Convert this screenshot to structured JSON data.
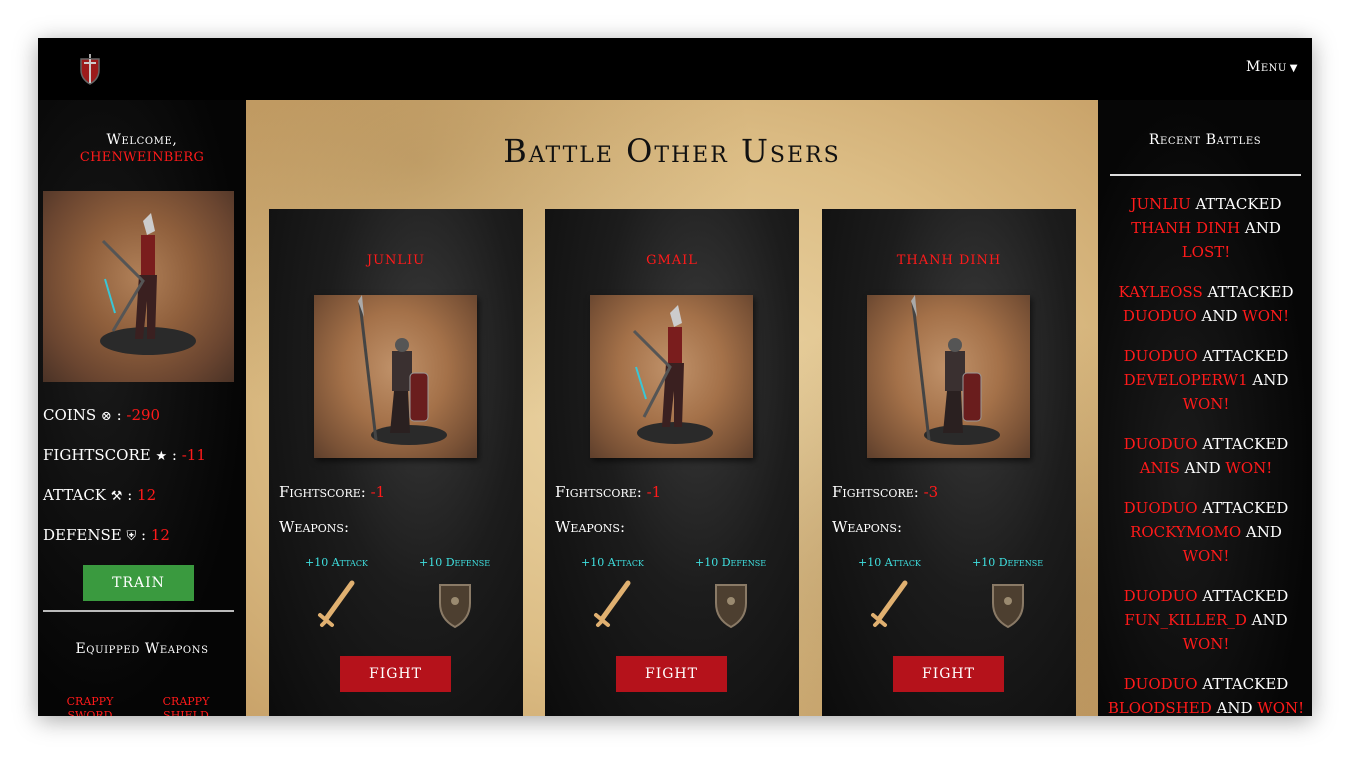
{
  "nav": {
    "menu_label": "Menu"
  },
  "left": {
    "welcome": "Welcome,",
    "username": "CHENWEINBERG",
    "stats": {
      "coins_label": "COINS",
      "coins_value": "-290",
      "fightscore_label": "FIGHTSCORE",
      "fightscore_value": "-11",
      "attack_label": "ATTACK",
      "attack_value": "12",
      "defense_label": "DEFENSE",
      "defense_value": "12"
    },
    "train_label": "TRAIN",
    "equipped_title": "Equipped Weapons",
    "equipped": [
      "CRAPPY SWORD",
      "CRAPPY SHIELD"
    ]
  },
  "main": {
    "title": "Battle Other Users",
    "fightscore_label": "Fightscore:",
    "weapons_label": "Weapons:",
    "attack_bonus": "+10 Attack",
    "defense_bonus": "+10 Defense",
    "fight_label": "FIGHT",
    "opponents": [
      {
        "name": "JUNLIU",
        "fightscore": "-1"
      },
      {
        "name": "GMAIL",
        "fightscore": "-1"
      },
      {
        "name": "THANH DINH",
        "fightscore": "-3"
      }
    ]
  },
  "right": {
    "title": "Recent Battles",
    "battles": [
      {
        "attacker": "JUNLIU",
        "defender": "THANH DINH",
        "result": "LOST!"
      },
      {
        "attacker": "KAYLEOSS",
        "defender": "DUODUO",
        "result": "WON!"
      },
      {
        "attacker": "DUODUO",
        "defender": "DEVELOPERW1",
        "result": "WON!"
      },
      {
        "attacker": "DUODUO",
        "defender": "ANIS",
        "result": "WON!"
      },
      {
        "attacker": "DUODUO",
        "defender": "ROCKYMOMO",
        "result": "WON!"
      },
      {
        "attacker": "DUODUO",
        "defender": "FUN_KILLER_D",
        "result": "WON!"
      },
      {
        "attacker": "DUODUO",
        "defender": "BLOODSHED",
        "result": "WON!"
      }
    ]
  }
}
